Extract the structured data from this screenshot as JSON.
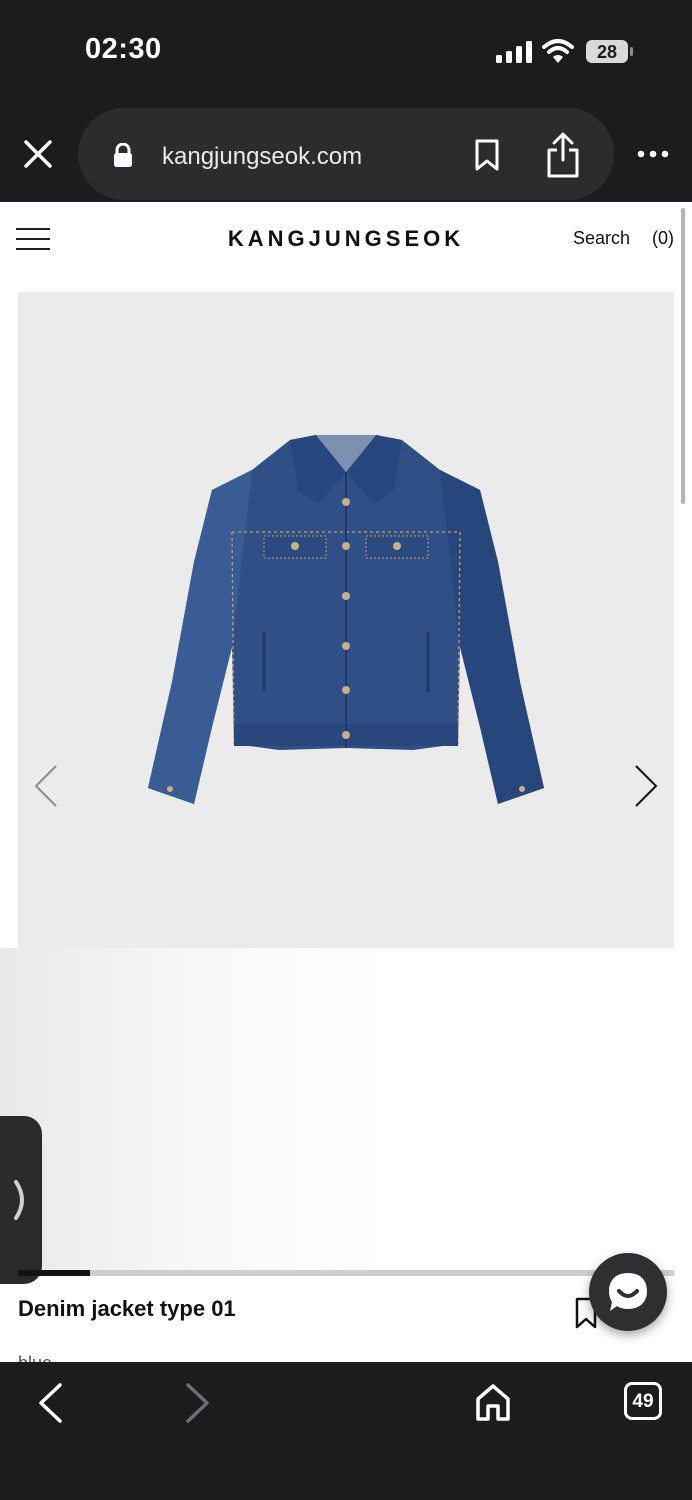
{
  "status_bar": {
    "time": "02:30",
    "battery": "28"
  },
  "browser": {
    "url": "kangjungseok.com",
    "tab_count": "49"
  },
  "site": {
    "logo": "KANGJUNGSEOK",
    "search_label": "Search",
    "cart_count": "(0)"
  },
  "product": {
    "name": "Denim jacket type 01",
    "color": "blue",
    "image_alt": "denim jacket",
    "gallery_progress": 0.11
  },
  "icons": {
    "status": [
      "signal-icon",
      "wifi-icon",
      "battery-icon"
    ],
    "browser_top": [
      "close-icon",
      "lock-icon",
      "bookmark-icon",
      "share-icon",
      "more-icon"
    ],
    "site": [
      "menu-icon"
    ],
    "gallery": [
      "chevron-left-icon",
      "chevron-right-icon"
    ],
    "floating": [
      "side-tab-chevron-icon",
      "chat-icon",
      "wishlist-icon"
    ],
    "browser_bottom": [
      "back-icon",
      "forward-icon",
      "home-icon",
      "tabs-icon"
    ]
  },
  "colors": {
    "browser_chrome": "#1c1c1e",
    "url_pill": "#2c2c2e",
    "denim": "#2f4f86",
    "image_bg": "#ebebeb"
  }
}
